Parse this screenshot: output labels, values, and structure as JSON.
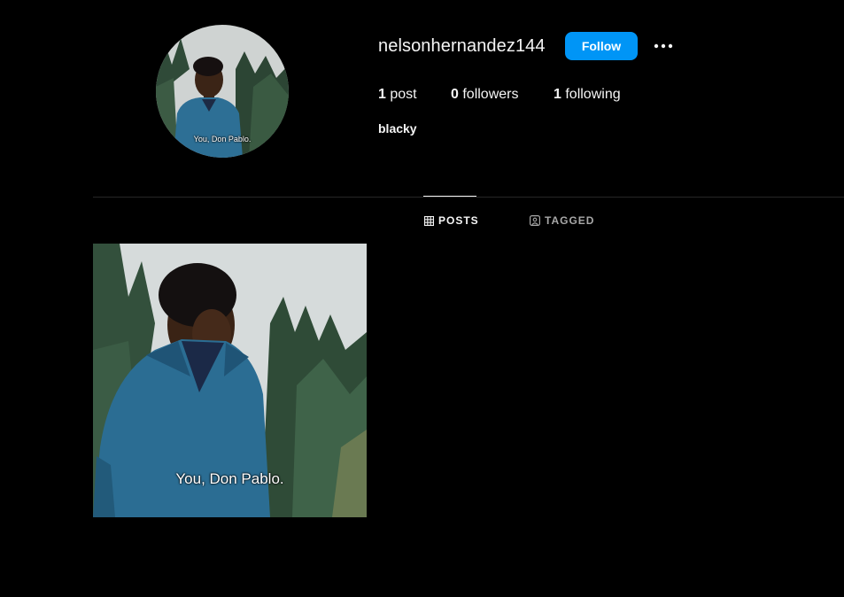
{
  "profile": {
    "username": "nelsonhernandez144",
    "follow_label": "Follow",
    "more_icon": "more-options-icon",
    "bio_name": "blacky",
    "avatar_caption": "You, Don Pablo."
  },
  "stats": {
    "posts_count": "1",
    "posts_label": " post",
    "followers_count": "0",
    "followers_label": " followers",
    "following_count": "1",
    "following_label": " following"
  },
  "tabs": {
    "posts_label": "POSTS",
    "tagged_label": "TAGGED",
    "active": "posts"
  },
  "posts": [
    {
      "caption": "You, Don Pablo."
    }
  ],
  "colors": {
    "background": "#000000",
    "accent": "#0095f6",
    "text": "#f5f5f5",
    "muted": "#a8a8a8",
    "divider": "#262626"
  }
}
